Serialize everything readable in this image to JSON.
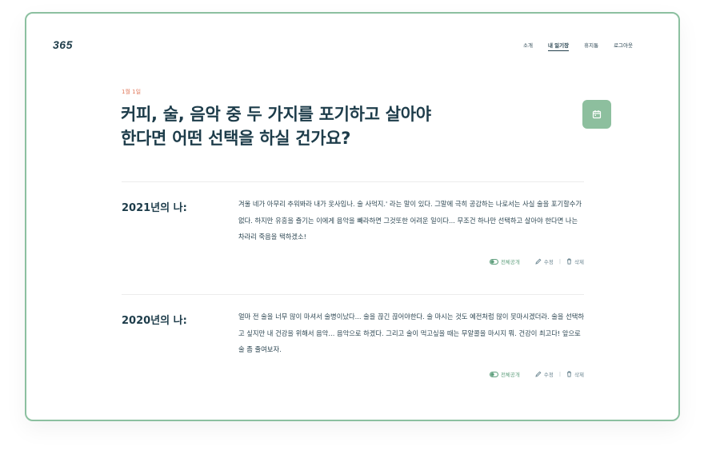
{
  "brand": {
    "logo": "365"
  },
  "nav": {
    "items": [
      "소개",
      "내 일기장",
      "휴지통",
      "로그아웃"
    ],
    "active_index": 1
  },
  "question": {
    "date": "1월 1일",
    "title_line1": "커피, 술, 음악 중 두 가지를 포기하고 살아야",
    "title_line2": "한다면 어떤 선택을 하실 건가요?"
  },
  "calendar_button": {
    "icon": "calendar-icon"
  },
  "entries": [
    {
      "year_label": "2021년의 나:",
      "text": "겨울 네가 아무리 추워봐라 내가 옷사입나. 술 사먹지.' 라는 말이 있다. 그말에 극히 공감하는 나로서는 사실 술을 포기할수가 없다. 하지만 유흥을 즐기는 이에게 음악을 빼라하면 그것또한 어려운 일이다... 무조건 하나만 선택하고 살아야 한다면 나는 차라리 죽음을 택하겠소!",
      "visibility": "전체공개",
      "edit": "수정",
      "delete": "삭제"
    },
    {
      "year_label": "2020년의 나:",
      "text": "얼마 전 술을 너무 많이 마셔서 술병이났다... 술을 끊긴 끊어야한다. 술 마시는 것도 예전처럼 많이 못마시겠더라. 술을 선택하고 싶지만 내 건강을 위해서 음악... 음악으로 하겠다. 그리고 술이 먹고싶을 때는 무알콜을 마시지 뭐. 건강이 최고다! 앞으로 술 좀 줄여보자.",
      "visibility": "전체공개",
      "edit": "수정",
      "delete": "삭제"
    }
  ],
  "colors": {
    "accent_green": "#8dbf9e",
    "date_orange": "#e27b5e",
    "text_dark": "#1d3c4a",
    "border_green": "#8cc0a0"
  }
}
